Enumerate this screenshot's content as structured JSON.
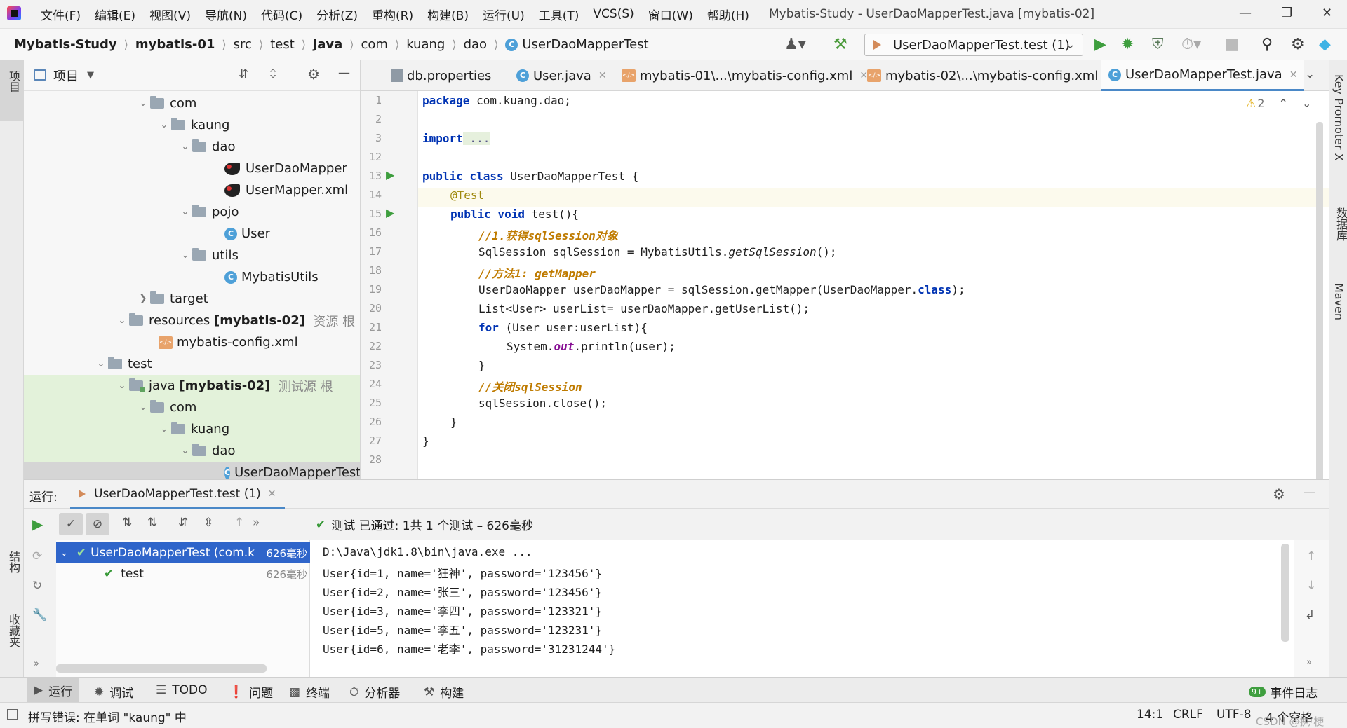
{
  "menubar": {
    "items": [
      "文件(F)",
      "编辑(E)",
      "视图(V)",
      "导航(N)",
      "代码(C)",
      "分析(Z)",
      "重构(R)",
      "构建(B)",
      "运行(U)",
      "工具(T)",
      "VCS(S)",
      "窗口(W)",
      "帮助(H)"
    ],
    "window_title": "Mybatis-Study - UserDaoMapperTest.java [mybatis-02]"
  },
  "breadcrumbs": [
    "Mybatis-Study",
    "mybatis-01",
    "src",
    "test",
    "java",
    "com",
    "kuang",
    "dao",
    "UserDaoMapperTest"
  ],
  "run_config": "UserDaoMapperTest.test (1)",
  "left_stripe": {
    "project": "项目",
    "structure": "结构",
    "favorites": "收藏夹"
  },
  "right_stripe": {
    "key_promoter": "Key Promoter X",
    "database": "数据库",
    "maven": "Maven"
  },
  "project_panel": {
    "title": "项目",
    "tree": [
      {
        "label": "com"
      },
      {
        "label": "kaung"
      },
      {
        "label": "dao"
      },
      {
        "label": "UserDaoMapper"
      },
      {
        "label": "UserMapper.xml"
      },
      {
        "label": "pojo"
      },
      {
        "label": "User"
      },
      {
        "label": "utils"
      },
      {
        "label": "MybatisUtils"
      },
      {
        "label": "target"
      },
      {
        "label": "resources",
        "bold": "[mybatis-02]",
        "hint": "资源 根"
      },
      {
        "label": "mybatis-config.xml"
      },
      {
        "label": "test"
      },
      {
        "label": "java",
        "bold": "[mybatis-02]",
        "hint": "测试源 根"
      },
      {
        "label": "com"
      },
      {
        "label": "kuang"
      },
      {
        "label": "dao"
      },
      {
        "label": "UserDaoMapperTest"
      }
    ]
  },
  "editor_tabs": [
    {
      "label": "db.properties"
    },
    {
      "label": "User.java"
    },
    {
      "label": "mybatis-01\\...\\mybatis-config.xml"
    },
    {
      "label": "mybatis-02\\...\\mybatis-config.xml"
    },
    {
      "label": "UserDaoMapperTest.java"
    }
  ],
  "editor": {
    "warning_count": "2",
    "line_numbers": [
      "1",
      "2",
      "3",
      "12",
      "13",
      "14",
      "15",
      "16",
      "17",
      "18",
      "19",
      "20",
      "21",
      "22",
      "23",
      "24",
      "25",
      "26",
      "27",
      "28"
    ],
    "code": {
      "l1_kw": "package",
      "l1_rest": " com.kuang.dao;",
      "l3_kw": "import",
      "l3_fold": " ...",
      "l13_kw": "public class",
      "l13_rest": " UserDaoMapperTest {",
      "l14": "@Test",
      "l15_kw": "public void",
      "l15_rest": " test(){",
      "l16": "//1.获得sqlSession对象",
      "l17_a": "SqlSession sqlSession = MybatisUtils.",
      "l17_b": "getSqlSession",
      "l17_c": "();",
      "l18": "//方法1: getMapper",
      "l19_a": "UserDaoMapper userDaoMapper = sqlSession.getMapper(UserDaoMapper.",
      "l19_b": "class",
      "l19_c": ");",
      "l20": "List<User> userList= userDaoMapper.getUserList();",
      "l21_kw": "for",
      "l21_rest": " (User user:userList){",
      "l22_a": "System.",
      "l22_b": "out",
      "l22_c": ".println(user);",
      "l23": "}",
      "l24": "//关闭sqlSession",
      "l25": "sqlSession.close();",
      "l26": "}",
      "l27": "}"
    }
  },
  "run_panel": {
    "label": "运行:",
    "tab": "UserDaoMapperTest.test (1)",
    "status": "测试 已通过: 1共 1 个测试 – 626毫秒",
    "tests": [
      {
        "name": "UserDaoMapperTest (com.k",
        "time": "626毫秒"
      },
      {
        "name": "test",
        "time": "626毫秒"
      }
    ],
    "console": [
      "D:\\Java\\jdk1.8\\bin\\java.exe ...",
      "User{id=1, name='狂神', password='123456'}",
      "User{id=2, name='张三', password='123456'}",
      "User{id=3, name='李四', password='123321'}",
      "User{id=5, name='李五', password='123231'}",
      "User{id=6, name='老李', password='31231244'}"
    ]
  },
  "tool_windows": [
    "运行",
    "调试",
    "TODO",
    "问题",
    "终端",
    "分析器",
    "构建"
  ],
  "event_log": "事件日志",
  "status_bar": {
    "message": "拼写错误: 在单词 \"kaung\" 中",
    "position": "14:1",
    "line_sep": "CRLF",
    "encoding": "UTF-8",
    "indent": "4 个空格",
    "watermark": "CSDN @执 梗"
  }
}
